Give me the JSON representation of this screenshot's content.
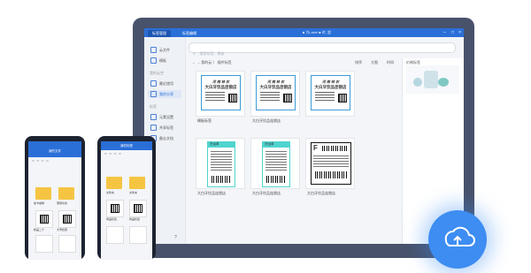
{
  "app": {
    "tabs": [
      "标签管理",
      "标签编辑"
    ],
    "title": "■ 为Label ■ 时, 超",
    "search_placeholder": "搜索标签、模板"
  },
  "sidebar": {
    "top_items": [
      "云文件",
      "模板"
    ],
    "section1": "我的云空",
    "section1_items": [
      "最近使用",
      "我的分享"
    ],
    "section2": "标签",
    "section2_items": [
      "元素设置",
      "共享标签",
      "备忘文档"
    ]
  },
  "breadcrumb": "我的云 〉 插件标签",
  "toolbar": {
    "sort": "排序",
    "view": "大图",
    "time": "时间"
  },
  "cards": [
    {
      "name": "模板标签",
      "head": "河 南 林 农",
      "title": "大白牙饮品连锁店"
    },
    {
      "name": "大白牙饮品连锁店",
      "head": "河 南 林 农",
      "title": "大白牙饮品连锁店"
    },
    {
      "name": "",
      "head": "河 南 林 农",
      "title": "大白牙饮品连锁店"
    },
    {
      "name": "大白牙饮品连锁店",
      "head": "货运单",
      "title": ""
    },
    {
      "name": "大白牙饮品连锁店",
      "head": "货运单",
      "title": ""
    },
    {
      "name": "大白牙饮品连锁店",
      "head": "F",
      "title": ""
    }
  ],
  "right_panel": {
    "title": "价格标签"
  },
  "phone_left": {
    "header": "我的文件",
    "items": [
      "摩卡咖啡",
      "薄荷牛奶",
      "新品二十",
      "大号奶茶"
    ]
  },
  "phone_right": {
    "header": "我的标签",
    "items": [
      "文件夹",
      "文件夹",
      "商品标签",
      "商品标签"
    ]
  }
}
